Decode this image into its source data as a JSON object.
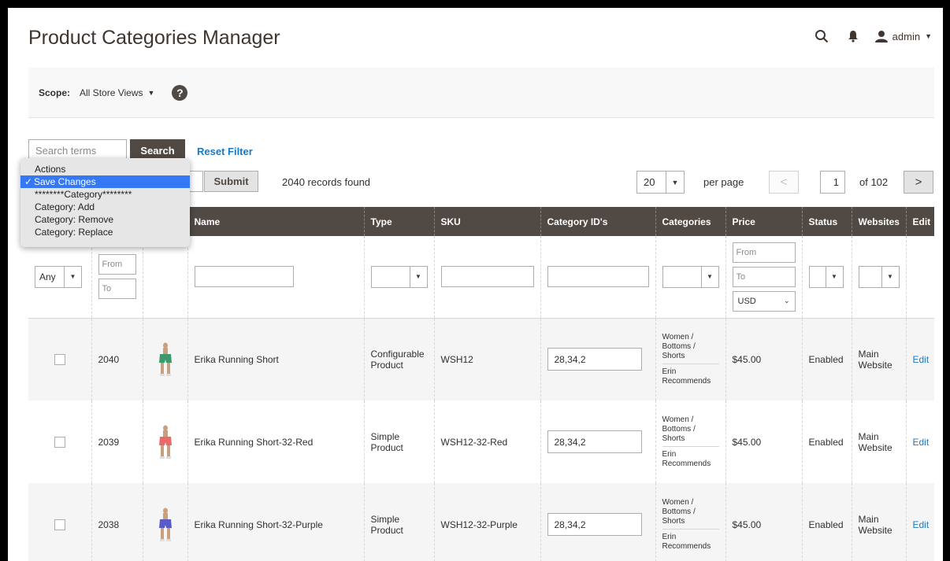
{
  "header": {
    "title": "Product Categories Manager",
    "user": "admin"
  },
  "scope": {
    "label": "Scope:",
    "value": "All Store Views"
  },
  "search": {
    "placeholder": "Search terms",
    "button": "Search",
    "reset": "Reset Filter"
  },
  "actions_dropdown": {
    "items": [
      "Actions",
      "Save Changes",
      "********Category********",
      "Category: Add",
      "Category: Remove",
      "Category: Replace"
    ],
    "selected_index": 1
  },
  "toolbar": {
    "submit": "Submit",
    "records": "2040 records found",
    "per_page_value": "20",
    "per_page_label": "per page",
    "page_current": "1",
    "page_of": "of 102"
  },
  "table": {
    "columns": [
      "",
      "",
      "",
      "Name",
      "Type",
      "SKU",
      "Category ID's",
      "Categories",
      "Price",
      "Status",
      "Websites",
      "Edit"
    ],
    "filters": {
      "any": "Any",
      "from": "From",
      "to": "To",
      "currency": "USD"
    },
    "rows": [
      {
        "id": "2040",
        "name": "Erika Running Short",
        "type": "Configurable Product",
        "sku": "WSH12",
        "category_ids": "28,34,2",
        "category_1": "Women / Bottoms / Shorts",
        "category_2": "Erin Recommends",
        "price": "$45.00",
        "status": "Enabled",
        "website": "Main Website",
        "edit": "Edit",
        "thumb_color": "#3a9a6e"
      },
      {
        "id": "2039",
        "name": "Erika Running Short-32-Red",
        "type": "Simple Product",
        "sku": "WSH12-32-Red",
        "category_ids": "28,34,2",
        "category_1": "Women / Bottoms / Shorts",
        "category_2": "Erin Recommends",
        "price": "$45.00",
        "status": "Enabled",
        "website": "Main Website",
        "edit": "Edit",
        "thumb_color": "#e86a6a"
      },
      {
        "id": "2038",
        "name": "Erika Running Short-32-Purple",
        "type": "Simple Product",
        "sku": "WSH12-32-Purple",
        "category_ids": "28,34,2",
        "category_1": "Women / Bottoms / Shorts",
        "category_2": "Erin Recommends",
        "price": "$45.00",
        "status": "Enabled",
        "website": "Main Website",
        "edit": "Edit",
        "thumb_color": "#5b5bc8"
      }
    ]
  },
  "colors": {
    "header_bg": "#514943",
    "link": "#1979c3",
    "selected": "#3478f6"
  }
}
